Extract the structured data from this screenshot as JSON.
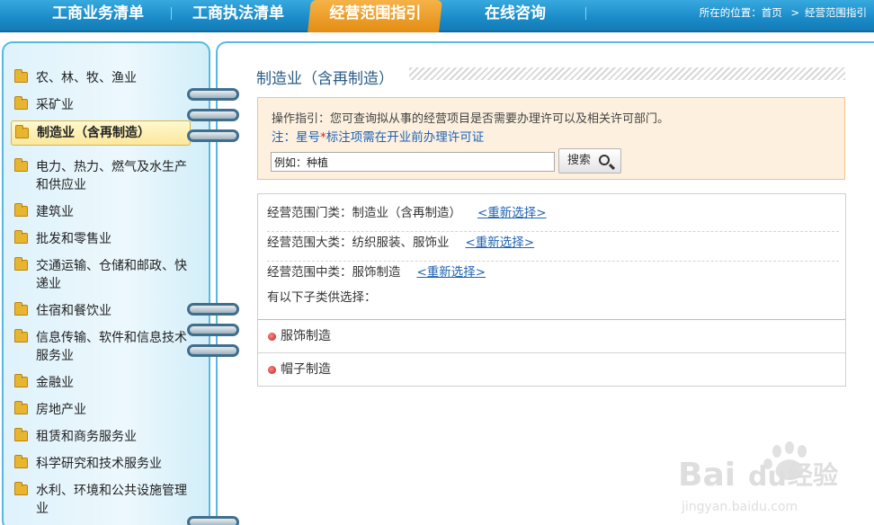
{
  "nav": {
    "tabs": [
      {
        "label": "工商业务清单"
      },
      {
        "label": "工商执法清单"
      },
      {
        "label": "经营范围指引"
      },
      {
        "label": "在线咨询"
      }
    ],
    "breadcrumb_prefix": "所在的位置：",
    "breadcrumb_home": "首页",
    "breadcrumb_sep": ">",
    "breadcrumb_current": "经营范围指引"
  },
  "sidebar": {
    "items": [
      {
        "label": "农、林、牧、渔业"
      },
      {
        "label": "采矿业"
      },
      {
        "label": "制造业（含再制造）"
      },
      {
        "label": "电力、热力、燃气及水生产和供应业"
      },
      {
        "label": "建筑业"
      },
      {
        "label": "批发和零售业"
      },
      {
        "label": "交通运输、仓储和邮政、快递业"
      },
      {
        "label": "住宿和餐饮业"
      },
      {
        "label": "信息传输、软件和信息技术服务业"
      },
      {
        "label": "金融业"
      },
      {
        "label": "房地产业"
      },
      {
        "label": "租赁和商务服务业"
      },
      {
        "label": "科学研究和技术服务业"
      },
      {
        "label": "水利、环境和公共设施管理业"
      }
    ]
  },
  "main": {
    "title": "制造业（含再制造）",
    "guide_text": "操作指引：您可查询拟从事的经营项目是否需要办理许可以及相关许可部门。",
    "note_prefix": "注：星号",
    "note_star": "*",
    "note_suffix": "标注项需在开业前办理许可证",
    "search_value": "例如：种植",
    "search_button": "搜索",
    "selections": [
      {
        "label": "经营范围门类：制造业（含再制造）",
        "reset": "<重新选择>"
      },
      {
        "label": "经营范围大类：纺织服装、服饰业",
        "reset": "<重新选择>"
      },
      {
        "label": "经营范围中类：服饰制造",
        "reset": "<重新选择>"
      }
    ],
    "sub_note": "有以下子类供选择：",
    "options": [
      {
        "label": "服饰制造"
      },
      {
        "label": "帽子制造"
      }
    ]
  },
  "watermark": {
    "text1": "Bai",
    "text2": "du",
    "text3": "经验",
    "url": "jingyan.baidu.com"
  },
  "colors": {
    "nav_blue": "#1a8bc8",
    "active_tab": "#e38d12",
    "link_blue": "#1f62b4",
    "star_red": "#e02020"
  }
}
